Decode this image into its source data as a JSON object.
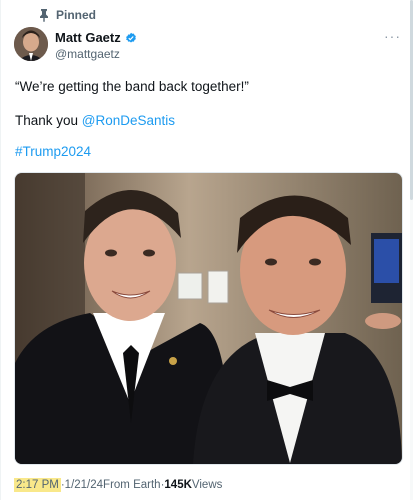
{
  "pinned": {
    "label": "Pinned",
    "icon": "pin-icon"
  },
  "author": {
    "name": "Matt Gaetz",
    "handle": "@mattgaetz",
    "verified_icon": "verified-badge-icon",
    "verified_color": "#1d9bf0"
  },
  "tweet": {
    "line1": "“We’re getting the band back together!”",
    "line2_prefix": "Thank you ",
    "mention": "@RonDeSantis",
    "hashtag": "#Trump2024"
  },
  "meta": {
    "time": "2:17 PM",
    "sep1": " · ",
    "date": "1/21/24",
    "source": " From Earth",
    "sep2": " · ",
    "views_count": "145K",
    "views_label": " Views"
  },
  "colors": {
    "accent": "#1d9bf0",
    "secondary_text": "#536471",
    "time_highlight": "#f9e88a"
  }
}
